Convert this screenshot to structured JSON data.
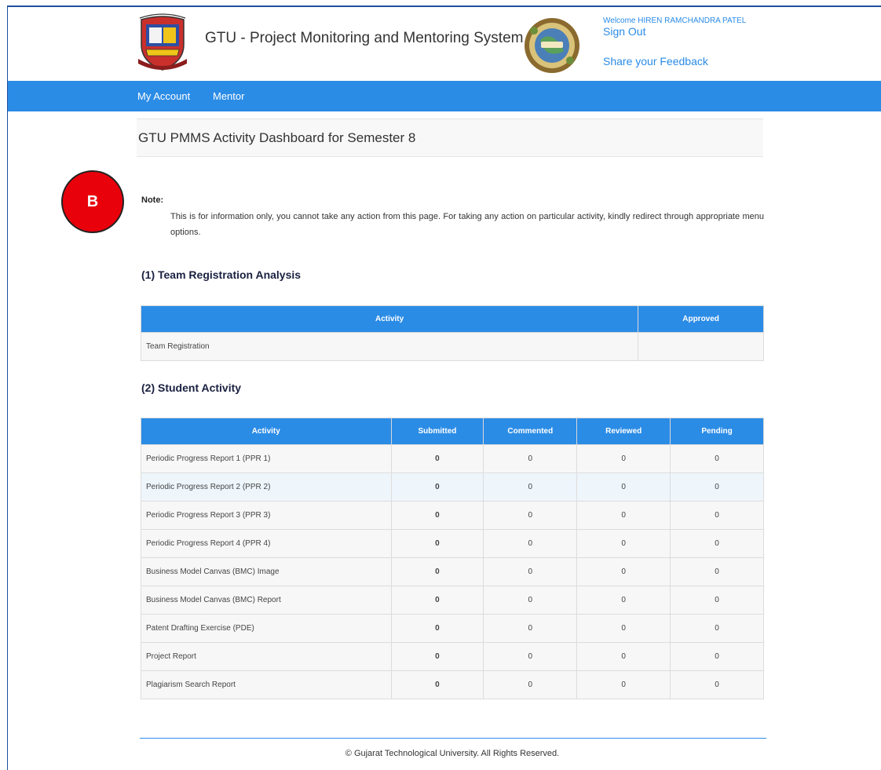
{
  "header": {
    "title": "GTU - Project Monitoring and Mentoring System",
    "welcome": "Welcome HIREN RAMCHANDRA PATEL",
    "sign_out": "Sign Out",
    "feedback": "Share your Feedback",
    "left_logo_icon": "gtu-crest-logo",
    "right_logo_icon": "innovation-globe-logo"
  },
  "nav": {
    "items": [
      "My Account",
      "Mentor"
    ]
  },
  "page": {
    "title": "GTU PMMS Activity Dashboard for Semester 8"
  },
  "marker": {
    "label": "B",
    "color": "#e8000b"
  },
  "note": {
    "label": "Note:",
    "text": "This is for information only, you cannot take any action from this page. For taking any action on particular activity, kindly redirect through appropriate menu options."
  },
  "team_registration": {
    "heading": "(1) Team Registration Analysis",
    "columns": [
      "Activity",
      "Approved"
    ],
    "rows": [
      {
        "activity": "Team Registration",
        "approved": ""
      }
    ]
  },
  "student_activity": {
    "heading": "(2) Student Activity",
    "columns": [
      "Activity",
      "Submitted",
      "Commented",
      "Reviewed",
      "Pending"
    ],
    "rows": [
      {
        "activity": "Periodic Progress Report 1 (PPR 1)",
        "submitted": "0",
        "commented": "0",
        "reviewed": "0",
        "pending": "0"
      },
      {
        "activity": "Periodic Progress Report 2 (PPR 2)",
        "submitted": "0",
        "commented": "0",
        "reviewed": "0",
        "pending": "0"
      },
      {
        "activity": "Periodic Progress Report 3 (PPR 3)",
        "submitted": "0",
        "commented": "0",
        "reviewed": "0",
        "pending": "0"
      },
      {
        "activity": "Periodic Progress Report 4 (PPR 4)",
        "submitted": "0",
        "commented": "0",
        "reviewed": "0",
        "pending": "0"
      },
      {
        "activity": "Business Model Canvas (BMC) Image",
        "submitted": "0",
        "commented": "0",
        "reviewed": "0",
        "pending": "0"
      },
      {
        "activity": "Business Model Canvas (BMC) Report",
        "submitted": "0",
        "commented": "0",
        "reviewed": "0",
        "pending": "0"
      },
      {
        "activity": "Patent Drafting Exercise (PDE)",
        "submitted": "0",
        "commented": "0",
        "reviewed": "0",
        "pending": "0"
      },
      {
        "activity": "Project Report",
        "submitted": "0",
        "commented": "0",
        "reviewed": "0",
        "pending": "0"
      },
      {
        "activity": "Plagiarism Search Report",
        "submitted": "0",
        "commented": "0",
        "reviewed": "0",
        "pending": "0"
      }
    ]
  },
  "footer": {
    "text": "© Gujarat Technological University. All Rights Reserved."
  },
  "colors": {
    "accent": "#2b8ce6",
    "link": "#2a8be6"
  }
}
